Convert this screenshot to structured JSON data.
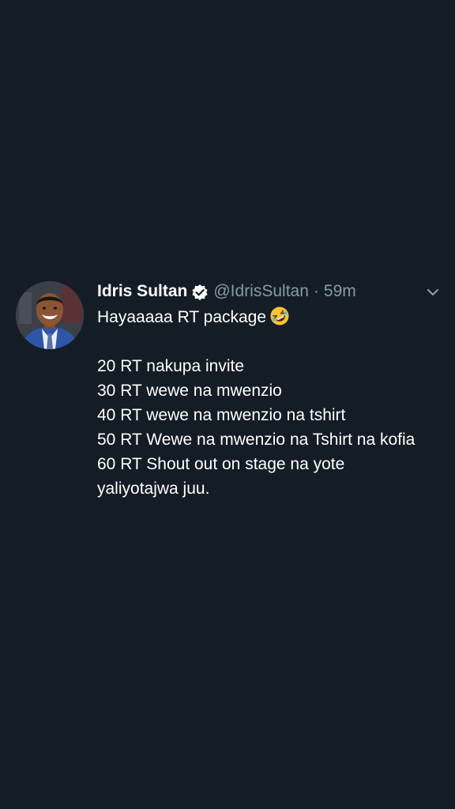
{
  "tweet": {
    "author": {
      "display_name": "Idris Sultan",
      "handle": "@IdrisSultan",
      "verified": true,
      "avatar_icon": "person-portrait"
    },
    "separator": "·",
    "timestamp": "59m",
    "menu_icon": "chevron-down-icon",
    "lines": [
      "Hayaaaaa RT package",
      "",
      "20 RT nakupa invite",
      "30 RT wewe na mwenzio",
      "40 RT wewe na mwenzio na tshirt",
      "50 RT Wewe na mwenzio na Tshirt na kofia",
      "60 RT Shout out on stage na yote yaliyotajwa juu."
    ],
    "emoji": "rolling-on-floor-laughing"
  },
  "colors": {
    "background": "#141d26",
    "text": "#ffffff",
    "secondary_text": "#8899a6",
    "verified_badge": "#ffffff"
  }
}
